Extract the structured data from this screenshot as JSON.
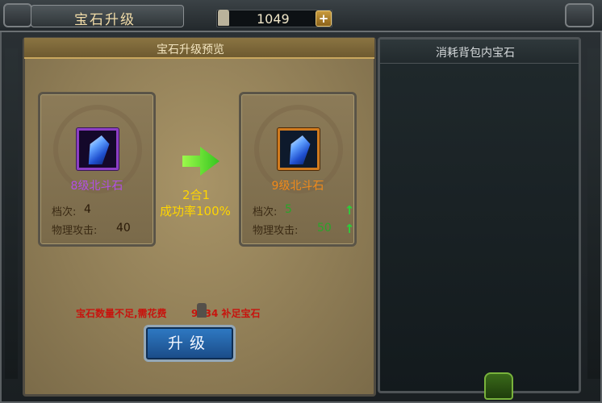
{
  "window": {
    "title": "宝石升级"
  },
  "currency": {
    "value": "1049",
    "icon": "tower-icon",
    "add_label": "+"
  },
  "preview": {
    "header": "宝石升级预览",
    "source": {
      "name": "8级北斗石",
      "rank_label": "档次:",
      "rank_value": "4",
      "attack_label": "物理攻击:",
      "attack_value": "40"
    },
    "target": {
      "name": "9级北斗石",
      "rank_label": "档次:",
      "rank_value": "5",
      "attack_label": "物理攻击:",
      "attack_value": "50"
    },
    "merge_text": "2合1",
    "rate_text": "成功率100%"
  },
  "warning": {
    "prefix": "宝石数量不足,需花费",
    "cost": "9034",
    "suffix": "补足宝石"
  },
  "upgrade_button": {
    "label": "升级"
  },
  "inventory": {
    "header": "消耗背包内宝石"
  },
  "colors": {
    "purple_quality": "#8c3ec4",
    "orange_quality": "#d07a1e",
    "success_yellow": "#ffd500",
    "stat_up_green": "#2aa52a",
    "warning_red": "#c7140e"
  }
}
